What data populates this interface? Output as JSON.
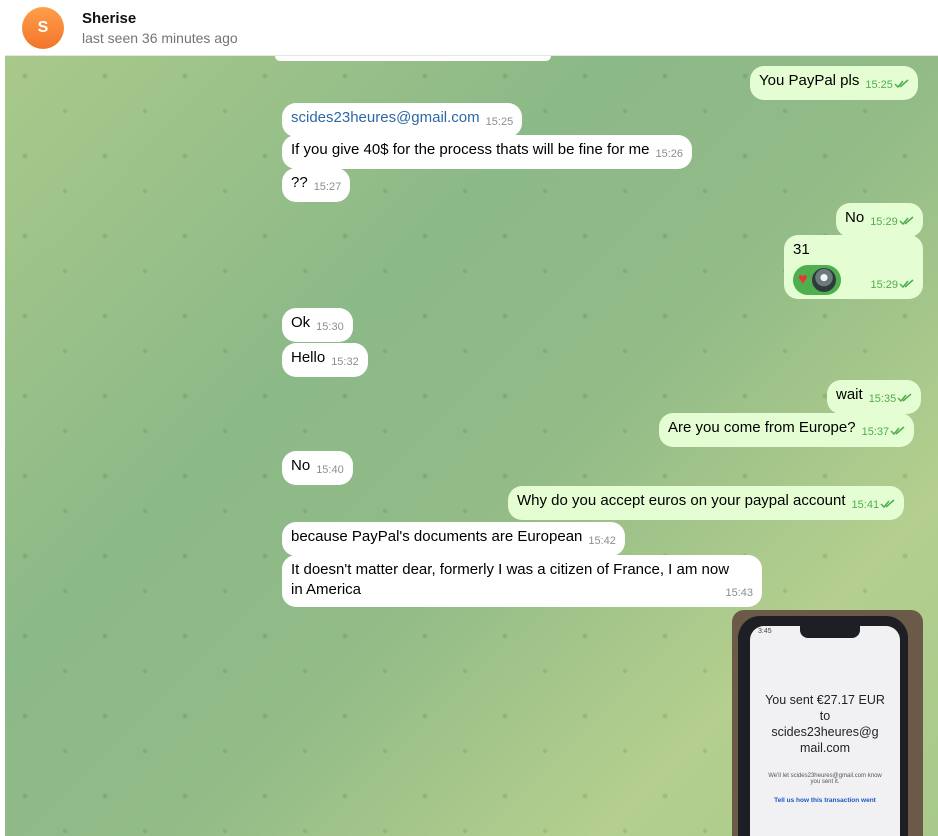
{
  "header": {
    "avatar_letter": "S",
    "name": "Sherise",
    "status": "last seen 36 minutes ago"
  },
  "messages": [
    {
      "dir": "out",
      "text": "You PayPal pls",
      "time": "15:25"
    },
    {
      "dir": "in",
      "text": "scides23heures@gmail.com",
      "time": "15:25",
      "link": true
    },
    {
      "dir": "in",
      "text": "If you give 40$ for the process thats will be fine for me",
      "time": "15:26"
    },
    {
      "dir": "in",
      "text": "??",
      "time": "15:27"
    },
    {
      "dir": "out",
      "text": "No",
      "time": "15:29"
    },
    {
      "dir": "out",
      "text": "31",
      "time": "15:29",
      "reactions": [
        "heart-reaction",
        "user-avatar-reaction"
      ]
    },
    {
      "dir": "in",
      "text": "Ok",
      "time": "15:30"
    },
    {
      "dir": "in",
      "text": "Hello",
      "time": "15:32"
    },
    {
      "dir": "out",
      "text": "wait",
      "time": "15:35"
    },
    {
      "dir": "out",
      "text": "Are you come from Europe?",
      "time": "15:37"
    },
    {
      "dir": "in",
      "text": "No",
      "time": "15:40"
    },
    {
      "dir": "out",
      "text": "Why do you accept euros on your paypal account",
      "time": "15:41"
    },
    {
      "dir": "in",
      "text": "because PayPal's documents are European",
      "time": "15:42"
    },
    {
      "dir": "in",
      "line1": "It doesn't matter dear, formerly I was a citizen of France, I am now",
      "line2": "in America",
      "time": "15:43"
    }
  ],
  "photo": {
    "phone_time": "3:45",
    "sent_line1": "You sent €27.17 EUR",
    "sent_line2": "to",
    "sent_line3": "scides23heures@g",
    "sent_line4": "mail.com",
    "note_line1": "We'll let scides23heures@gmail.com know",
    "note_line2": "you sent it.",
    "link": "Tell us how this transaction went"
  },
  "colors": {
    "incoming_bubble": "#ffffff",
    "outgoing_bubble": "#e5fdd3",
    "read_ticks": "#4fae4e",
    "link": "#2d68a6",
    "avatar": "#f2752b"
  }
}
